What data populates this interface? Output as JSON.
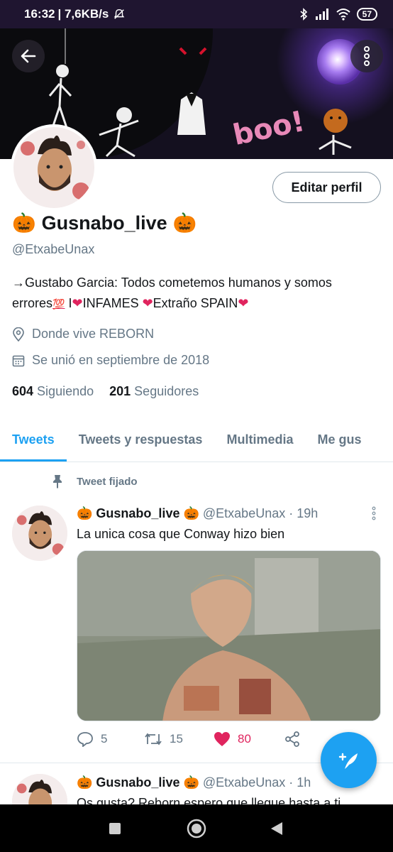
{
  "status_bar": {
    "time": "16:32",
    "network_speed": "| 7,6KB/s",
    "battery": "57",
    "icons": [
      "dnd-off-icon",
      "bluetooth-icon",
      "signal-icon",
      "wifi-icon",
      "battery-icon"
    ]
  },
  "header": {
    "back_icon": "arrow-left-icon",
    "more_icon": "more-vertical-icon",
    "banner_text": "boo!"
  },
  "profile": {
    "edit_button": "Editar perfil",
    "display_name": "Gusnabo_live",
    "name_emoji": "🎃",
    "handle": "@EtxabeUnax",
    "bio": {
      "part1": "→Gustabo Garcia: Todos cometemos humanos y somos errores",
      "emoji_100": "💯",
      "part2": " I",
      "heart": "❤",
      "part3": "INFAMES  ",
      "part4": "Extraño SPAIN"
    },
    "location": "Donde vive REBORN",
    "joined": "Se unió en septiembre de 2018",
    "following_count": "604",
    "following_label": "Siguiendo",
    "followers_count": "201",
    "followers_label": "Seguidores"
  },
  "tabs": [
    {
      "label": "Tweets",
      "active": true
    },
    {
      "label": "Tweets y respuestas",
      "active": false
    },
    {
      "label": "Multimedia",
      "active": false
    },
    {
      "label": "Me gus",
      "active": false
    }
  ],
  "pinned_label": "Tweet fijado",
  "tweets": [
    {
      "name": "Gusnabo_live",
      "handle": "@EtxabeUnax",
      "time": "· 19h",
      "text": "La unica cosa que Conway hizo bien",
      "replies": "5",
      "retweets": "15",
      "likes": "80"
    },
    {
      "name": "Gusnabo_live",
      "handle": "@EtxabeUnax",
      "time": "· 1h",
      "text": "Os gusta? Reborn espero que llegue hasta a ti"
    }
  ],
  "colors": {
    "accent": "#1da1f2",
    "like": "#e0245e",
    "secondary_text": "#657786"
  }
}
